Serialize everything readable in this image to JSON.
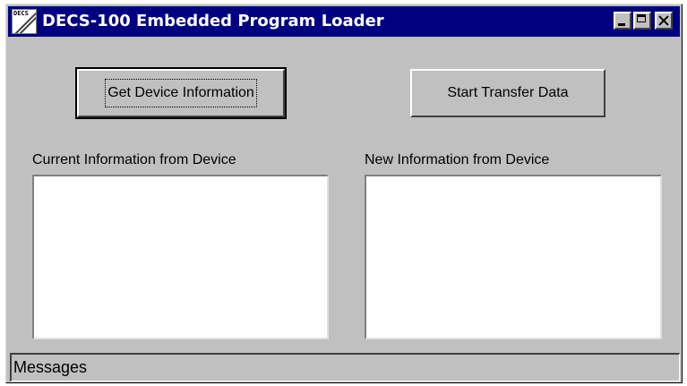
{
  "window": {
    "title": "DECS-100 Embedded Program Loader",
    "icon_label": "DECS",
    "icon_name": "app-icon",
    "buttons": [
      "minimize-icon",
      "maximize-icon",
      "close-icon"
    ]
  },
  "actions": {
    "get_device_info_label": "Get Device Information",
    "start_transfer_label": "Start Transfer Data"
  },
  "panels": {
    "current": {
      "label": "Current Information from Device",
      "content": ""
    },
    "new": {
      "label": "New Information from Device",
      "content": ""
    }
  },
  "statusbar": {
    "text": "Messages"
  },
  "colors": {
    "face": "#c0c0c0",
    "titlebar": "#000080",
    "field": "#ffffff"
  }
}
